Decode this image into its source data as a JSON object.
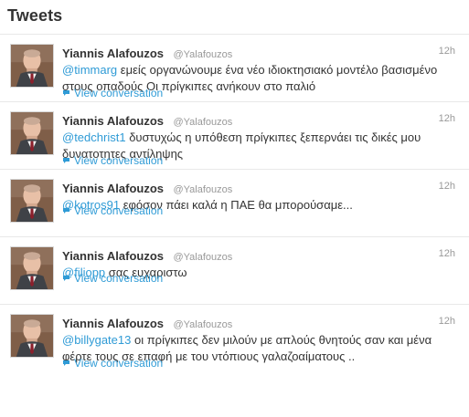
{
  "header": {
    "title": "Tweets"
  },
  "tweets": [
    {
      "fullname": "Yiannis Alafouzos",
      "username": "@Yalafouzos",
      "time": "12h",
      "mention": "@timmarg",
      "text": "εμείς οργανώνουμε ένα νέο ιδιοκτησιακό μοντέλο βασισμένο στους οπαδούς Οι πρίγκιπες ανήκουν στο παλιό",
      "view_conversation": "View conversation"
    },
    {
      "fullname": "Yiannis Alafouzos",
      "username": "@Yalafouzos",
      "time": "12h",
      "mention": "@tedchrist1",
      "text": "δυστυχώς η υπόθεση πρίγκιπες ξεπερνάει τις δικές μου δυνατοτητες αντίληψης",
      "view_conversation": "View conversation"
    },
    {
      "fullname": "Yiannis Alafouzos",
      "username": "@Yalafouzos",
      "time": "12h",
      "mention": "@kotros91",
      "text": "εφόσον πάει καλά η ΠΑΕ θα μπορούσαμε...",
      "view_conversation": "View conversation"
    },
    {
      "fullname": "Yiannis Alafouzos",
      "username": "@Yalafouzos",
      "time": "12h",
      "mention": "@filiopp",
      "text": "σας ευχαριστω",
      "view_conversation": "View conversation"
    },
    {
      "fullname": "Yiannis Alafouzos",
      "username": "@Yalafouzos",
      "time": "12h",
      "mention": "@billygate13",
      "text": "οι πρίγκιπες δεν μιλούν με απλούς θνητούς σαν και μένα φέρτε τους σε επαφή με του ντόπιους γαλαζοαίματους ..",
      "view_conversation": "View conversation"
    }
  ],
  "colors": {
    "link": "#2f9bd6",
    "text": "#333333",
    "muted": "#999999",
    "border": "#e8e8e8"
  },
  "icons": {
    "conversation": "speech-bubble-icon"
  }
}
